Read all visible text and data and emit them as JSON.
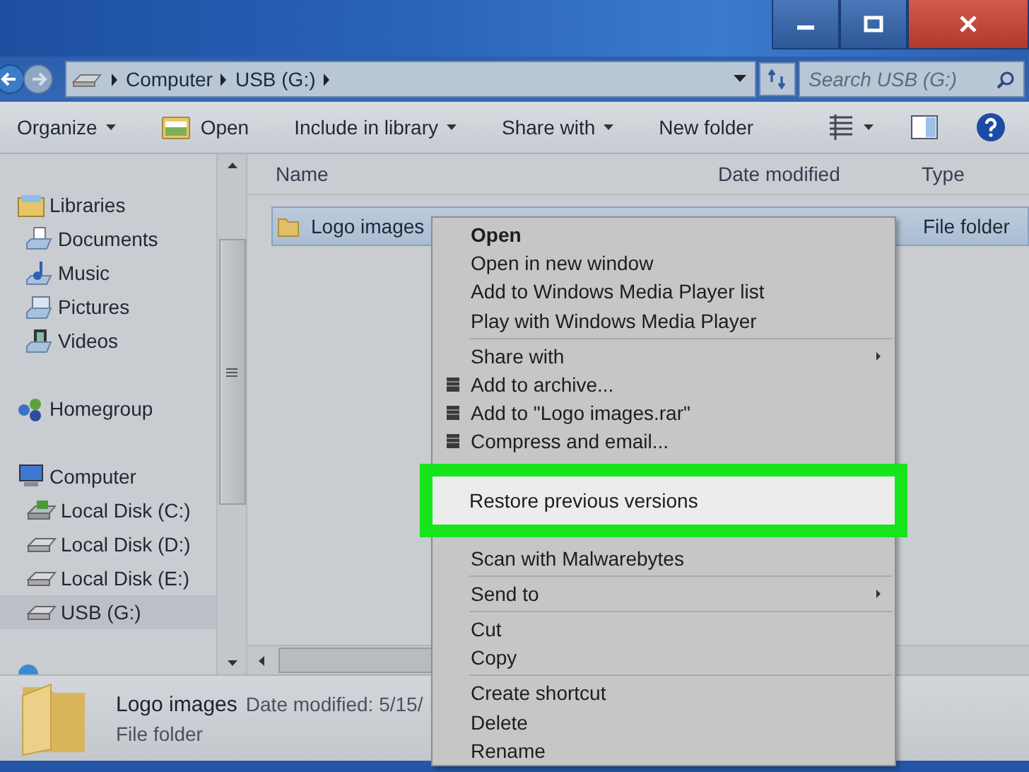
{
  "address_bar": {
    "crumbs": [
      "Computer",
      "USB (G:)"
    ],
    "search_placeholder": "Search USB (G:)"
  },
  "toolbar": {
    "items": [
      {
        "label": "Organize",
        "dropdown": true,
        "icon": false
      },
      {
        "label": "Open",
        "dropdown": false,
        "icon": true
      },
      {
        "label": "Include in library",
        "dropdown": true,
        "icon": false
      },
      {
        "label": "Share with",
        "dropdown": true,
        "icon": false
      },
      {
        "label": "New folder",
        "dropdown": false,
        "icon": false
      }
    ]
  },
  "navigation": [
    {
      "label": "Libraries",
      "kind": "libraries",
      "selected": false,
      "children": [
        {
          "label": "Documents",
          "kind": "documents",
          "selected": false
        },
        {
          "label": "Music",
          "kind": "music",
          "selected": false
        },
        {
          "label": "Pictures",
          "kind": "pictures",
          "selected": false
        },
        {
          "label": "Videos",
          "kind": "videos",
          "selected": false
        }
      ]
    },
    {
      "label": "Homegroup",
      "kind": "homegroup",
      "selected": false
    },
    {
      "label": "Computer",
      "kind": "computer",
      "selected": false,
      "children": [
        {
          "label": "Local Disk (C:)",
          "kind": "system",
          "selected": false
        },
        {
          "label": "Local Disk (D:)",
          "kind": "drive",
          "selected": false
        },
        {
          "label": "Local Disk (E:)",
          "kind": "drive",
          "selected": false
        },
        {
          "label": "USB (G:)",
          "kind": "drive",
          "selected": true
        }
      ]
    }
  ],
  "file_list": {
    "columns": [
      "Name",
      "Date modified",
      "Type"
    ],
    "rows": [
      {
        "name": "Logo images",
        "type": "File folder",
        "selected": true
      }
    ]
  },
  "context_menu": [
    {
      "kind": "item",
      "label": "Open",
      "bold": true,
      "submenu": false,
      "icon": false
    },
    {
      "kind": "item",
      "label": "Open in new window",
      "bold": false,
      "submenu": false,
      "icon": false
    },
    {
      "kind": "item",
      "label": "Add to Windows Media Player list",
      "bold": false,
      "submenu": false,
      "icon": false
    },
    {
      "kind": "item",
      "label": "Play with Windows Media Player",
      "bold": false,
      "submenu": false,
      "icon": false
    },
    {
      "kind": "separator"
    },
    {
      "kind": "item",
      "label": "Share with",
      "bold": false,
      "submenu": true,
      "icon": false
    },
    {
      "kind": "item",
      "label": "Add to archive...",
      "bold": false,
      "submenu": false,
      "icon": true
    },
    {
      "kind": "item",
      "label": "Add to \"Logo images.rar\"",
      "bold": false,
      "submenu": false,
      "icon": true
    },
    {
      "kind": "item",
      "label": "Compress and email...",
      "bold": false,
      "submenu": false,
      "icon": true
    },
    {
      "kind": "callout",
      "label": "Restore previous versions"
    },
    {
      "kind": "item",
      "label": "Scan with Malwarebytes",
      "bold": false,
      "submenu": false,
      "icon": false
    },
    {
      "kind": "separator"
    },
    {
      "kind": "item",
      "label": "Send to",
      "bold": false,
      "submenu": true,
      "icon": false
    },
    {
      "kind": "separator"
    },
    {
      "kind": "item",
      "label": "Cut",
      "bold": false,
      "submenu": false,
      "icon": false
    },
    {
      "kind": "item",
      "label": "Copy",
      "bold": false,
      "submenu": false,
      "icon": false
    },
    {
      "kind": "separator"
    },
    {
      "kind": "item",
      "label": "Create shortcut",
      "bold": false,
      "submenu": false,
      "icon": false
    },
    {
      "kind": "item",
      "label": "Delete",
      "bold": false,
      "submenu": false,
      "icon": false
    },
    {
      "kind": "item",
      "label": "Rename",
      "bold": false,
      "submenu": false,
      "icon": false
    }
  ],
  "details_pane": {
    "name": "Logo images",
    "meta": "Date modified: 5/15/",
    "type": "File folder"
  }
}
